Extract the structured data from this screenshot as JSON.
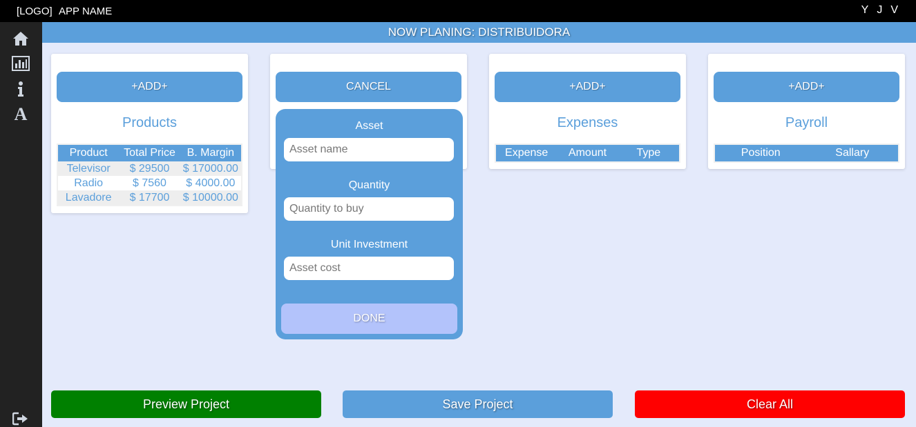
{
  "topbar": {
    "logo": "[LOGO]",
    "app_name": "APP NAME",
    "users": [
      "Y",
      "J",
      "V"
    ]
  },
  "sidebar": {
    "icons": [
      "home-icon",
      "chart-icon",
      "info-icon",
      "font-icon"
    ],
    "bottom_icon": "logout-icon"
  },
  "header": {
    "title": "NOW PLANING: DISTRIBUIDORA"
  },
  "products": {
    "button": "+ADD+",
    "title": "Products",
    "columns": [
      "Product",
      "Total Price",
      "B. Margin"
    ],
    "rows": [
      [
        "Televisor",
        "$ 29500",
        "$ 17000.00"
      ],
      [
        "Radio",
        "$ 7560",
        "$ 4000.00"
      ],
      [
        "Lavadore",
        "$ 17700",
        "$ 10000.00"
      ]
    ]
  },
  "assets": {
    "button": "CANCEL",
    "form": {
      "asset_label": "Asset",
      "asset_placeholder": "Asset name",
      "quantity_label": "Quantity",
      "quantity_placeholder": "Quantity to buy",
      "unit_label": "Unit Investment",
      "unit_placeholder": "Asset cost",
      "done": "DONE"
    }
  },
  "expenses": {
    "button": "+ADD+",
    "title": "Expenses",
    "columns": [
      "Expense",
      "Amount",
      "Type"
    ]
  },
  "payroll": {
    "button": "+ADD+",
    "title": "Payroll",
    "columns": [
      "Position",
      "Sallary"
    ]
  },
  "actions": {
    "preview": "Preview Project",
    "save": "Save Project",
    "clear": "Clear All"
  },
  "colors": {
    "accent": "#5b9fdb",
    "preview": "#008000",
    "save": "#5b9fdb",
    "clear": "#ff0000",
    "done": "#b3c3fb"
  }
}
